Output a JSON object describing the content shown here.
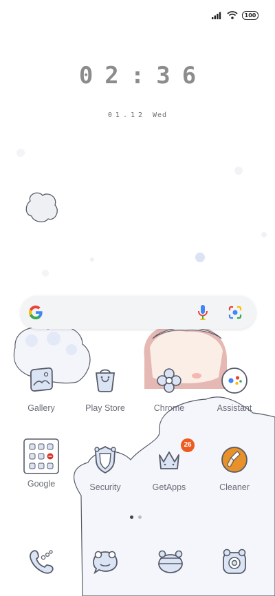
{
  "status_bar": {
    "battery_level": "100",
    "icons": [
      "signal-icon",
      "wifi-icon",
      "battery-icon"
    ]
  },
  "clock": {
    "time": "02:36",
    "date": "01.12",
    "weekday": "Wed"
  },
  "search_bar": {
    "icons": [
      "google-logo-icon",
      "microphone-icon",
      "google-lens-icon"
    ]
  },
  "apps_row1": [
    {
      "label": "Gallery",
      "icon": "gallery-icon"
    },
    {
      "label": "Play Store",
      "icon": "play-store-icon"
    },
    {
      "label": "Chrome",
      "icon": "chrome-icon"
    },
    {
      "label": "Assistant",
      "icon": "assistant-icon"
    }
  ],
  "apps_row2": [
    {
      "label": "Google",
      "icon": "google-folder-icon"
    },
    {
      "label": "Security",
      "icon": "security-icon"
    },
    {
      "label": "GetApps",
      "icon": "getapps-icon",
      "badge": "26"
    },
    {
      "label": "Cleaner",
      "icon": "cleaner-icon"
    }
  ],
  "page_indicator": {
    "pages": 2,
    "current": 1
  },
  "dock": [
    {
      "icon": "phone-icon"
    },
    {
      "icon": "messages-icon"
    },
    {
      "icon": "browser-icon"
    },
    {
      "icon": "camera-icon"
    }
  ],
  "colors": {
    "accent_badge": "#ee5a1f",
    "icon_outline": "#555a66",
    "icon_fill": "#dbe4f5",
    "cleaner_orange": "#e8902a",
    "clock_gray": "#8c8c8c"
  }
}
